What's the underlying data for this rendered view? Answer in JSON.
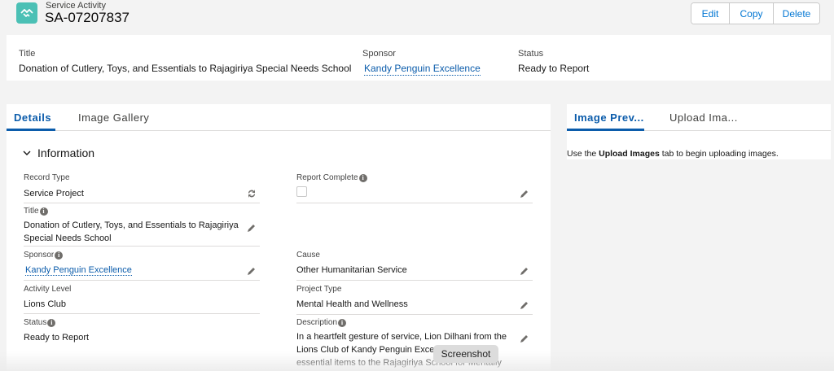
{
  "header": {
    "object_type": "Service Activity",
    "record_name": "SA-07207837",
    "icon": "handshake-icon",
    "actions": {
      "edit": "Edit",
      "copy": "Copy",
      "delete": "Delete"
    }
  },
  "highlights": {
    "title": {
      "label": "Title",
      "value": "Donation of Cutlery, Toys, and Essentials to Rajagiriya Special Needs School"
    },
    "sponsor": {
      "label": "Sponsor",
      "value": "Kandy Penguin Excellence"
    },
    "status": {
      "label": "Status",
      "value": "Ready to Report"
    }
  },
  "left_tabs": [
    "Details",
    "Image Gallery"
  ],
  "section": {
    "title": "Information",
    "icon": "chevron-down-icon"
  },
  "fields": {
    "record_type": {
      "label": "Record Type",
      "value": "Service Project",
      "icon": "change-record-type-icon"
    },
    "report_complete": {
      "label": "Report Complete",
      "checked": false
    },
    "title": {
      "label": "Title",
      "value": "Donation of Cutlery, Toys, and Essentials to Rajagiriya Special Needs School"
    },
    "sponsor": {
      "label": "Sponsor",
      "value": "Kandy Penguin Excellence"
    },
    "cause": {
      "label": "Cause",
      "value": "Other Humanitarian Service"
    },
    "activity_level": {
      "label": "Activity Level",
      "value": "Lions Club"
    },
    "project_type": {
      "label": "Project Type",
      "value": "Mental Health and Wellness"
    },
    "status": {
      "label": "Status",
      "value": "Ready to Report"
    },
    "description": {
      "label": "Description",
      "value": "In a heartfelt gesture of service, Lion Dilhani from the Lions Club of Kandy Penguin Excellence donated essential items to the Rajagiriya School for Mentally"
    }
  },
  "right_tabs": [
    "Image Prev...",
    "Upload Ima..."
  ],
  "right_message": {
    "prefix": "Use the ",
    "bold": "Upload Images",
    "suffix": " tab to begin uploading images."
  },
  "tooltip": "Screenshot",
  "colors": {
    "accent": "#0b5cab",
    "icon_bg": "#4bc0b5"
  }
}
